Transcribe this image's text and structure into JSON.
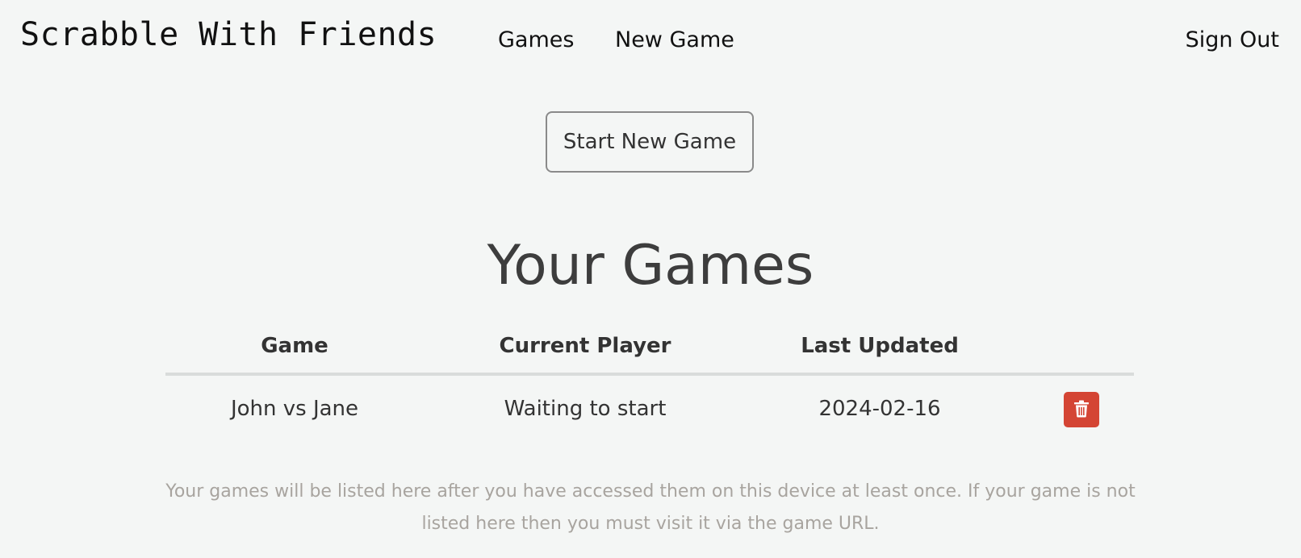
{
  "nav": {
    "brand": "Scrabble With Friends",
    "games": "Games",
    "new_game": "New Game",
    "sign_out": "Sign Out"
  },
  "main": {
    "start_button": "Start New Game",
    "title": "Your Games",
    "table": {
      "headers": {
        "game": "Game",
        "current_player": "Current Player",
        "last_updated": "Last Updated"
      },
      "rows": [
        {
          "game": "John vs Jane",
          "current_player": "Waiting to start",
          "last_updated": "2024-02-16",
          "action_icon": "trash-icon"
        }
      ]
    },
    "footnote": "Your games will be listed here after you have accessed them on this device at least once. If your game is not listed here then you must visit it via the game URL."
  },
  "colors": {
    "background": "#f4f6f5",
    "delete_button": "#d44534",
    "footnote_text": "#a8a49f"
  }
}
